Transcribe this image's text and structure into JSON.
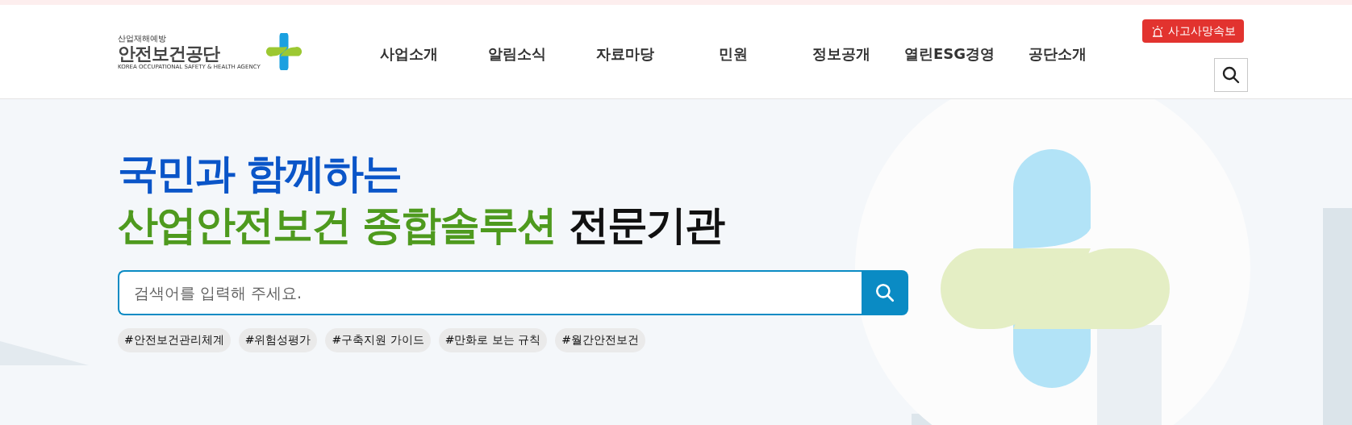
{
  "logo": {
    "tagline": "산업재해예방",
    "name": "안전보건공단",
    "english": "KOREA OCCUPATIONAL SAFETY & HEALTH AGENCY"
  },
  "nav": [
    {
      "label": "사업소개"
    },
    {
      "label": "알림소식"
    },
    {
      "label": "자료마당"
    },
    {
      "label": "민원"
    },
    {
      "label": "정보공개"
    },
    {
      "label": "열린ESG경영"
    },
    {
      "label": "공단소개"
    }
  ],
  "alert_button": {
    "label": "사고사망속보"
  },
  "headline": [
    [
      {
        "text": "국민과 함께하는",
        "color": "#0a55c8"
      }
    ],
    [
      {
        "text": "산업안전보건 종합솔루션",
        "color": "#4e9a1e"
      },
      {
        "text": "전문기관",
        "color": "#111111"
      }
    ]
  ],
  "search": {
    "placeholder": "검색어를 입력해 주세요."
  },
  "tags": [
    "#안전보건관리체계",
    "#위험성평가",
    "#구축지원 가이드",
    "#만화로 보는 규칙",
    "#월간안전보건"
  ]
}
